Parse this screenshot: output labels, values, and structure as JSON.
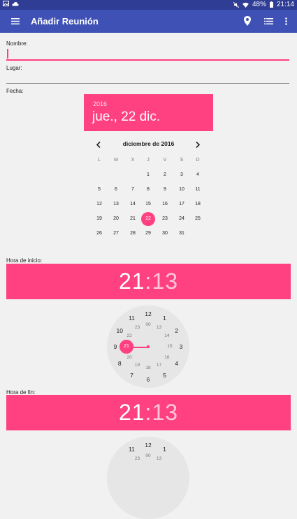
{
  "status_bar": {
    "battery": "48%",
    "time": "21:14"
  },
  "app_bar": {
    "title": "Añadir Reunión"
  },
  "form": {
    "name_label": "Nombre:",
    "place_label": "Lugar:",
    "date_label": "Fecha:",
    "start_label": "Hora de inicio:",
    "end_label": "Hora de fin:"
  },
  "date_picker": {
    "year": "2016",
    "date": "jue., 22 dic.",
    "month": "diciembre de 2016",
    "weekdays": [
      "L",
      "M",
      "X",
      "J",
      "V",
      "S",
      "D"
    ],
    "days": [
      [
        "",
        "",
        "",
        "1",
        "2",
        "3",
        "4"
      ],
      [
        "5",
        "6",
        "7",
        "8",
        "9",
        "10",
        "11"
      ],
      [
        "12",
        "13",
        "14",
        "15",
        "16",
        "17",
        "18"
      ],
      [
        "19",
        "20",
        "21",
        "22",
        "23",
        "24",
        "25"
      ],
      [
        "26",
        "27",
        "28",
        "29",
        "30",
        "31",
        ""
      ]
    ],
    "selected_day": "22"
  },
  "start_time": {
    "hour": "21",
    "minute": "13",
    "outer": [
      "12",
      "1",
      "2",
      "3",
      "4",
      "5",
      "6",
      "7",
      "8",
      "9",
      "10",
      "11"
    ],
    "inner": [
      "00",
      "13",
      "14",
      "15",
      "16",
      "17",
      "18",
      "19",
      "20",
      "21",
      "22",
      "23"
    ],
    "selected": "21"
  },
  "end_time": {
    "hour": "21",
    "minute": "13",
    "outer": [
      "12",
      "1",
      "11"
    ],
    "inner": [
      "00",
      "13",
      "23"
    ]
  },
  "colors": {
    "primary": "#3f51b5",
    "primary_dark": "#2f3d95",
    "accent": "#ff4081",
    "background": "#f1f1f1"
  }
}
